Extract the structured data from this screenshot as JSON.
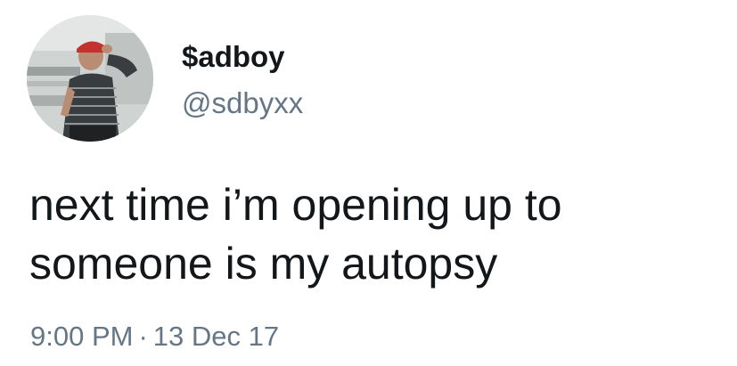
{
  "tweet": {
    "display_name": "$adboy",
    "handle": "@sdbyxx",
    "text_line_1": "next time i’m opening up to",
    "text_line_2": "someone is my autopsy",
    "time": "9:00 PM",
    "separator": "·",
    "date": "13 Dec 17"
  },
  "colors": {
    "text": "#14171a",
    "secondary": "#657786",
    "background": "#ffffff"
  }
}
